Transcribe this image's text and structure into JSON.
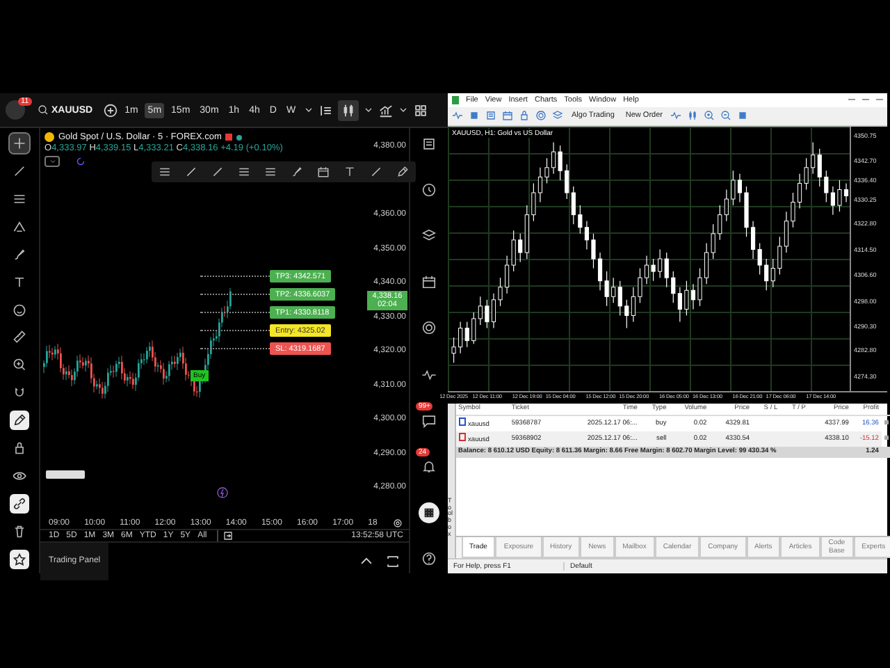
{
  "tradingview": {
    "toolbar": {
      "notification_count": "11",
      "symbol": "XAUUSD",
      "timeframes": [
        {
          "label": "1m",
          "selected": false
        },
        {
          "label": "5m",
          "selected": true
        },
        {
          "label": "15m",
          "selected": false
        },
        {
          "label": "30m",
          "selected": false
        },
        {
          "label": "1h",
          "selected": false
        },
        {
          "label": "4h",
          "selected": false
        },
        {
          "label": "D",
          "selected": false
        },
        {
          "label": "W",
          "selected": false
        }
      ]
    },
    "left_tools": [
      {
        "kind": "crosshair",
        "selected": true,
        "highlighted": false
      },
      {
        "kind": "line",
        "selected": false,
        "highlighted": false
      },
      {
        "kind": "lines",
        "selected": false,
        "highlighted": false
      },
      {
        "kind": "fork",
        "selected": false,
        "highlighted": false
      },
      {
        "kind": "brush",
        "selected": false,
        "highlighted": false
      },
      {
        "kind": "text",
        "selected": false,
        "highlighted": false
      },
      {
        "kind": "smiley",
        "selected": false,
        "highlighted": false
      },
      {
        "kind": "ruler",
        "selected": false,
        "highlighted": false
      },
      {
        "kind": "zoom",
        "selected": false,
        "highlighted": false
      },
      {
        "kind": "magnet",
        "selected": false,
        "highlighted": false
      },
      {
        "kind": "pencil",
        "selected": false,
        "highlighted": true
      },
      {
        "kind": "lock",
        "selected": false,
        "highlighted": false
      },
      {
        "kind": "eye",
        "selected": false,
        "highlighted": false
      },
      {
        "kind": "link",
        "selected": false,
        "highlighted": true
      },
      {
        "kind": "trash",
        "selected": false,
        "highlighted": false
      },
      {
        "kind": "star",
        "selected": false,
        "highlighted": true
      }
    ],
    "right_tools": [
      {
        "kind": "list"
      },
      {
        "kind": "clock"
      },
      {
        "kind": "layers"
      },
      {
        "kind": "calendar"
      },
      {
        "kind": "target"
      },
      {
        "kind": "pulse"
      },
      {
        "kind": "chat",
        "badge": "99+"
      },
      {
        "kind": "bell",
        "badge": "24"
      },
      {
        "kind": "apps"
      },
      {
        "kind": "help"
      }
    ],
    "legend": {
      "title": "Gold Spot / U.S. Dollar · 5 · FOREX.com",
      "ohlc": [
        {
          "label": "O",
          "value": "4,333.97"
        },
        {
          "label": "H",
          "value": "4,339.15"
        },
        {
          "label": "L",
          "value": "4,333.21"
        },
        {
          "label": "C",
          "value": "4,338.16"
        }
      ],
      "change": "+4.19 (+0.10%)"
    },
    "price_axis": [
      "4,380.00",
      "4,360.00",
      "4,350.00",
      "4,340.00",
      "4,330.00",
      "4,320.00",
      "4,310.00",
      "4,300.00",
      "4,290.00",
      "4,280.00"
    ],
    "order_tags": [
      {
        "kind": "tp",
        "label": "TP3: 4342.571"
      },
      {
        "kind": "tp",
        "label": "TP2: 4336.6037"
      },
      {
        "kind": "tp",
        "label": "TP1: 4330.8118"
      },
      {
        "kind": "entry",
        "label": "Entry: 4325.02"
      },
      {
        "kind": "sl",
        "label": "SL: 4319.1687"
      }
    ],
    "last_price": {
      "price": "4,338.16",
      "countdown": "02:04"
    },
    "buy_marker": "Buy",
    "time_axis": [
      "09:00",
      "10:00",
      "11:00",
      "12:00",
      "13:00",
      "14:00",
      "15:00",
      "16:00",
      "17:00",
      "18"
    ],
    "ranges": [
      "1D",
      "5D",
      "1M",
      "3M",
      "6M",
      "YTD",
      "1Y",
      "5Y",
      "All"
    ],
    "clock": "13:52:58 UTC",
    "trading_panel": "Trading Panel"
  },
  "metatrader": {
    "menu": [
      "File",
      "View",
      "Insert",
      "Charts",
      "Tools",
      "Window",
      "Help"
    ],
    "toolbar_buttons": [
      "Algo Trading",
      "New Order"
    ],
    "chart_data": {
      "type": "candlestick",
      "title": "XAUUSD, H1:  Gold vs US Dollar",
      "categories": [
        "12 Dec 2025",
        null,
        null,
        null,
        null,
        "12 Dec 11:00",
        null,
        null,
        null,
        null,
        null,
        "12 Dec 19:00",
        null,
        null,
        null,
        null,
        "15 Dec 04:00",
        null,
        null,
        null,
        null,
        null,
        "15 Dec 12:00",
        null,
        null,
        null,
        null,
        "15 Dec 20:00",
        null,
        null,
        null,
        null,
        null,
        "16 Dec 05:00",
        null,
        null,
        null,
        null,
        "16 Dec 13:00",
        null,
        null,
        null,
        null,
        null,
        "16 Dec 21:00",
        null,
        null,
        null,
        null,
        "17 Dec 06:00",
        null,
        null,
        null,
        null,
        null,
        "17 Dec 14:00",
        null,
        null,
        null,
        null
      ],
      "ohlc": [
        [
          4282,
          4287,
          4279,
          4284
        ],
        [
          4284,
          4292,
          4282,
          4290
        ],
        [
          4290,
          4292,
          4284,
          4286
        ],
        [
          4286,
          4295,
          4285,
          4293
        ],
        [
          4293,
          4300,
          4291,
          4297
        ],
        [
          4297,
          4299,
          4290,
          4292
        ],
        [
          4292,
          4301,
          4290,
          4299
        ],
        [
          4299,
          4306,
          4297,
          4303
        ],
        [
          4303,
          4313,
          4301,
          4310
        ],
        [
          4310,
          4321,
          4308,
          4318
        ],
        [
          4318,
          4320,
          4311,
          4314
        ],
        [
          4314,
          4329,
          4312,
          4326
        ],
        [
          4326,
          4336,
          4324,
          4333
        ],
        [
          4333,
          4341,
          4330,
          4338
        ],
        [
          4338,
          4344,
          4336,
          4341
        ],
        [
          4341,
          4349,
          4339,
          4346
        ],
        [
          4346,
          4348,
          4337,
          4340
        ],
        [
          4340,
          4342,
          4331,
          4333
        ],
        [
          4333,
          4335,
          4323,
          4326
        ],
        [
          4326,
          4329,
          4320,
          4322
        ],
        [
          4322,
          4324,
          4315,
          4318
        ],
        [
          4318,
          4320,
          4309,
          4312
        ],
        [
          4312,
          4314,
          4302,
          4305
        ],
        [
          4305,
          4308,
          4297,
          4300
        ],
        [
          4300,
          4306,
          4298,
          4303
        ],
        [
          4303,
          4305,
          4294,
          4297
        ],
        [
          4297,
          4299,
          4290,
          4294
        ],
        [
          4294,
          4303,
          4292,
          4300
        ],
        [
          4300,
          4309,
          4298,
          4306
        ],
        [
          4306,
          4313,
          4304,
          4310
        ],
        [
          4310,
          4312,
          4305,
          4308
        ],
        [
          4308,
          4315,
          4306,
          4312
        ],
        [
          4312,
          4314,
          4303,
          4306
        ],
        [
          4306,
          4308,
          4298,
          4301
        ],
        [
          4301,
          4303,
          4292,
          4296
        ],
        [
          4296,
          4305,
          4294,
          4302
        ],
        [
          4302,
          4304,
          4296,
          4299
        ],
        [
          4299,
          4309,
          4297,
          4306
        ],
        [
          4306,
          4317,
          4304,
          4314
        ],
        [
          4314,
          4323,
          4312,
          4320
        ],
        [
          4320,
          4329,
          4318,
          4326
        ],
        [
          4326,
          4334,
          4324,
          4331
        ],
        [
          4331,
          4340,
          4329,
          4337
        ],
        [
          4337,
          4339,
          4330,
          4333
        ],
        [
          4333,
          4335,
          4319,
          4322
        ],
        [
          4322,
          4324,
          4312,
          4315
        ],
        [
          4315,
          4317,
          4307,
          4310
        ],
        [
          4310,
          4312,
          4302,
          4305
        ],
        [
          4305,
          4312,
          4303,
          4309
        ],
        [
          4309,
          4319,
          4307,
          4316
        ],
        [
          4316,
          4327,
          4314,
          4324
        ],
        [
          4324,
          4333,
          4322,
          4330
        ],
        [
          4330,
          4339,
          4328,
          4336
        ],
        [
          4336,
          4344,
          4334,
          4341
        ],
        [
          4341,
          4349,
          4339,
          4345
        ],
        [
          4345,
          4347,
          4335,
          4338
        ],
        [
          4338,
          4340,
          4330,
          4333
        ],
        [
          4333,
          4335,
          4326,
          4329
        ],
        [
          4329,
          4337,
          4327,
          4334
        ],
        [
          4334,
          4336,
          4330,
          4332
        ]
      ],
      "ylim": [
        4270,
        4354
      ],
      "yticks": [
        {
          "value": 4350.75,
          "label": "4350.75"
        },
        {
          "value": 4342.7,
          "label": "4342.70"
        },
        {
          "value": 4336.4,
          "label": "4336.40"
        },
        {
          "value": 4330.25,
          "label": "4330.25"
        },
        {
          "value": 4322.8,
          "label": "4322.80"
        },
        {
          "value": 4314.5,
          "label": "4314.50"
        },
        {
          "value": 4306.6,
          "label": "4306.60"
        },
        {
          "value": 4298,
          "label": "4298.00"
        },
        {
          "value": 4290.3,
          "label": "4290.30"
        },
        {
          "value": 4282.8,
          "label": "4282.80"
        },
        {
          "value": 4274.3,
          "label": "4274.30"
        }
      ]
    },
    "columns": [
      "Symbol",
      "Ticket",
      "Time",
      "Type",
      "Volume",
      "Price",
      "S / L",
      "T / P",
      "Price",
      "Profit"
    ],
    "rows": [
      {
        "kind": "buy",
        "cells": [
          "xauusd",
          "59368787",
          "2025.12.17 06:...",
          "buy",
          "0.02",
          "4329.81",
          "",
          "",
          "4337.99",
          "16.36"
        ]
      },
      {
        "kind": "sell",
        "cells": [
          "xauusd",
          "59368902",
          "2025.12.17 06:...",
          "sell",
          "0.02",
          "4330.54",
          "",
          "",
          "4338.10",
          "-15.12"
        ]
      }
    ],
    "balance": "Balance: 8 610.12 USD  Equity: 8 611.36  Margin: 8.66  Free Margin: 8 602.70  Margin Level: 99 430.34 %",
    "balance_profit": "1.24",
    "toolbox_label": "Toolbox",
    "tabs": [
      {
        "label": "Trade",
        "selected": true
      },
      {
        "label": "Exposure",
        "selected": false
      },
      {
        "label": "History",
        "selected": false
      },
      {
        "label": "News",
        "selected": false
      },
      {
        "label": "Mailbox",
        "selected": false
      },
      {
        "label": "Calendar",
        "selected": false
      },
      {
        "label": "Company",
        "selected": false
      },
      {
        "label": "Alerts",
        "selected": false
      },
      {
        "label": "Articles",
        "selected": false
      },
      {
        "label": "Code Base",
        "selected": false
      },
      {
        "label": "Experts",
        "selected": false
      }
    ],
    "status": [
      "For Help, press F1",
      "Default"
    ]
  }
}
